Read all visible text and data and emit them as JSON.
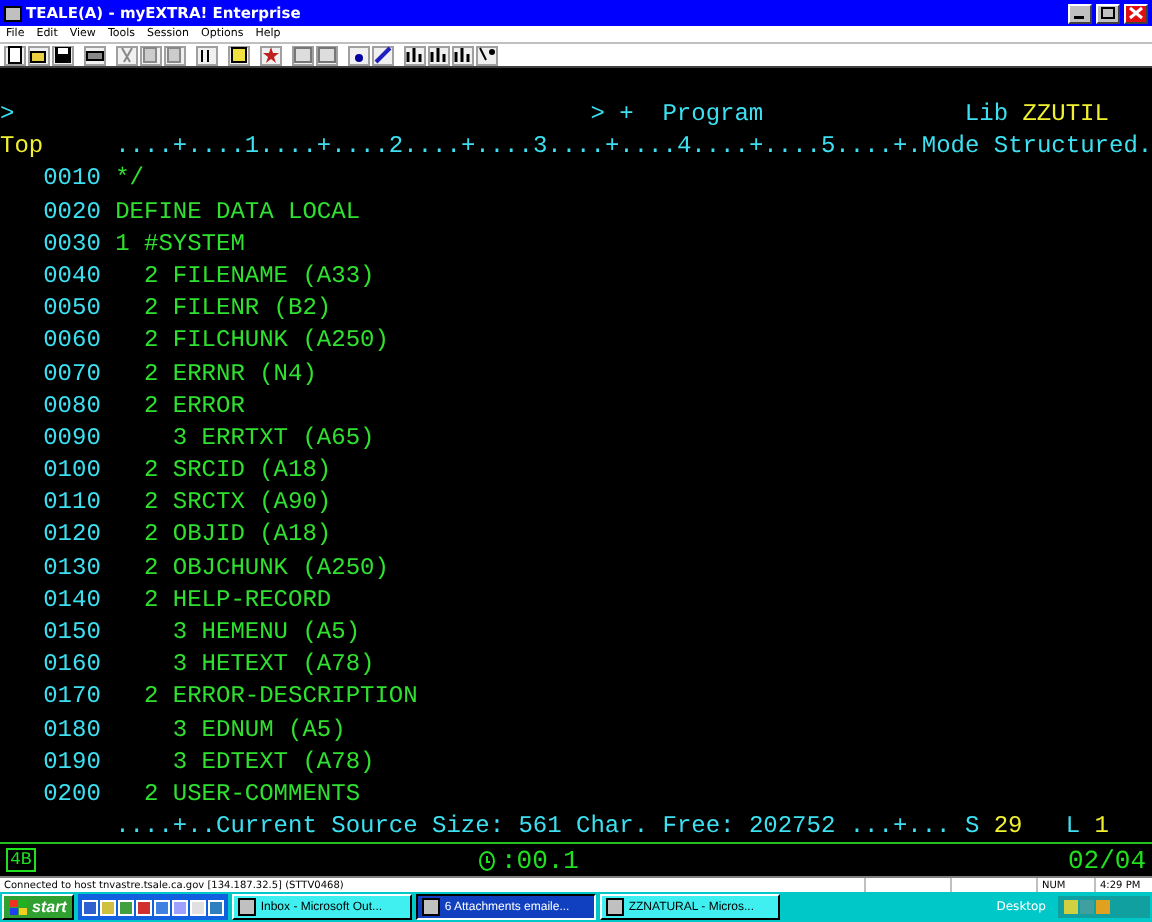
{
  "window": {
    "title": "TEALE(A) - myEXTRA! Enterprise"
  },
  "menu": [
    "File",
    "Edit",
    "View",
    "Tools",
    "Session",
    "Options",
    "Help"
  ],
  "terminal": {
    "header": [
      {
        "kind": "prompt",
        "text": ">"
      },
      {
        "kind": "command",
        "text": "> +  Program"
      },
      {
        "kind": "label",
        "text": "Lib"
      },
      {
        "kind": "value",
        "text": "ZZUTIL"
      }
    ],
    "ruler": {
      "label": "Top",
      "scale": "....+....1....+....2....+....3....+....4....+....5....+.Mode Structured."
    },
    "source_lines": [
      {
        "number": "0010",
        "code": "*/"
      },
      {
        "number": "0020",
        "code": "DEFINE DATA LOCAL"
      },
      {
        "number": "0030",
        "code": "1 #SYSTEM"
      },
      {
        "number": "0040",
        "code": "  2 FILENAME (A33)"
      },
      {
        "number": "0050",
        "code": "  2 FILENR (B2)"
      },
      {
        "number": "0060",
        "code": "  2 FILCHUNK (A250)"
      },
      {
        "number": "0070",
        "code": "  2 ERRNR (N4)"
      },
      {
        "number": "0080",
        "code": "  2 ERROR"
      },
      {
        "number": "0090",
        "code": "    3 ERRTXT (A65)"
      },
      {
        "number": "0100",
        "code": "  2 SRCID (A18)"
      },
      {
        "number": "0110",
        "code": "  2 SRCTX (A90)"
      },
      {
        "number": "0120",
        "code": "  2 OBJID (A18)"
      },
      {
        "number": "0130",
        "code": "  2 OBJCHUNK (A250)"
      },
      {
        "number": "0140",
        "code": "  2 HELP-RECORD"
      },
      {
        "number": "0150",
        "code": "    3 HEMENU (A5)"
      },
      {
        "number": "0160",
        "code": "    3 HETEXT (A78)"
      },
      {
        "number": "0170",
        "code": "  2 ERROR-DESCRIPTION"
      },
      {
        "number": "0180",
        "code": "    3 EDNUM (A5)"
      },
      {
        "number": "0190",
        "code": "    3 EDTEXT (A78)"
      },
      {
        "number": "0200",
        "code": "  2 USER-COMMENTS"
      }
    ],
    "footer": [
      {
        "kind": "label",
        "text": "....+..Current Source Size: 561 Char. Free: 202752 ...+... S"
      },
      {
        "kind": "value",
        "text": "29"
      },
      {
        "kind": "label",
        "text": "L"
      },
      {
        "kind": "value",
        "text": "1"
      }
    ]
  },
  "oia": {
    "session": "4B",
    "timer": ":00.1",
    "position": "02/04"
  },
  "status_bar": {
    "message": "Connected to host tnvastre.tsale.ca.gov [134.187.32.5] (STTV0468)",
    "num": "NUM",
    "time": "4:29 PM"
  },
  "taskbar": {
    "start": "start",
    "tasks": [
      {
        "label": "Inbox - Microsoft Out...",
        "selected": false
      },
      {
        "label": "6 Attachments emaile...",
        "selected": true
      },
      {
        "label": "ZZNATURAL - Micros...",
        "selected": false
      }
    ],
    "tray_label": "Desktop"
  }
}
